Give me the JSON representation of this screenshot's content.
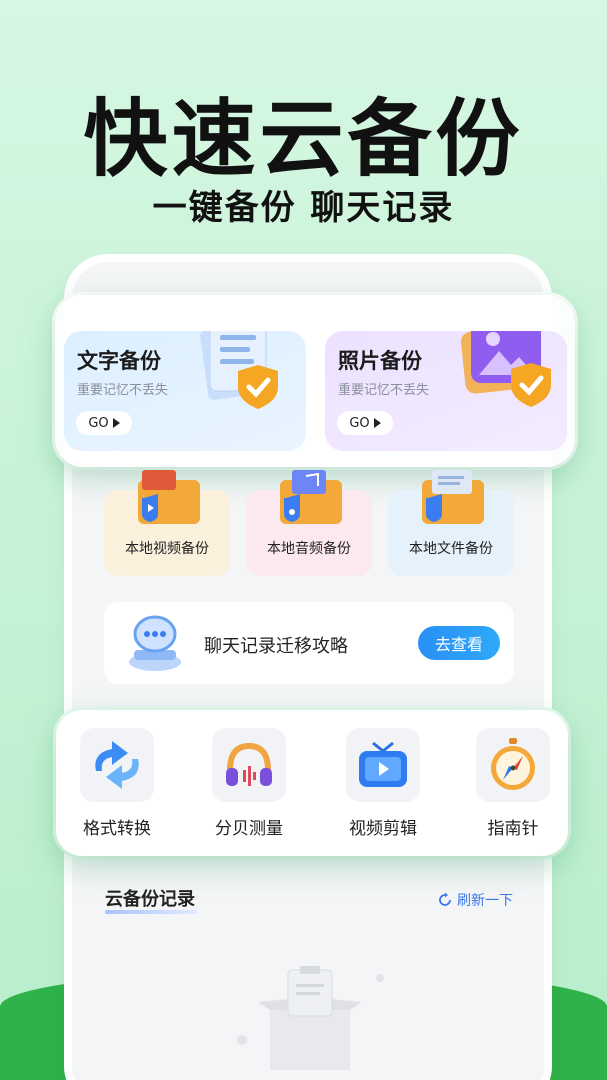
{
  "hero": {
    "title": "快速云备份",
    "subtitle": "一键备份 聊天记录"
  },
  "backup_cards": [
    {
      "title": "文字备份",
      "desc": "重要记忆不丢失",
      "go": "GO"
    },
    {
      "title": "照片备份",
      "desc": "重要记忆不丢失",
      "go": "GO"
    }
  ],
  "local_backups": [
    {
      "label": "本地视频备份",
      "icon": "video-folder-icon"
    },
    {
      "label": "本地音频备份",
      "icon": "music-folder-icon"
    },
    {
      "label": "本地文件备份",
      "icon": "file-folder-icon"
    }
  ],
  "chat_migration": {
    "label": "聊天记录迁移攻略",
    "button": "去查看",
    "icon": "chat-migration-icon"
  },
  "tools": [
    {
      "label": "格式转换",
      "icon": "format-convert-icon"
    },
    {
      "label": "分贝测量",
      "icon": "headphones-icon"
    },
    {
      "label": "视频剪辑",
      "icon": "tv-play-icon"
    },
    {
      "label": "指南针",
      "icon": "compass-icon"
    }
  ],
  "cloud_records": {
    "title": "云备份记录",
    "refresh": "刷新一下"
  },
  "colors": {
    "accent_blue": "#2a8ff7",
    "green": "#2fb24a",
    "shield_orange": "#f5a623"
  }
}
